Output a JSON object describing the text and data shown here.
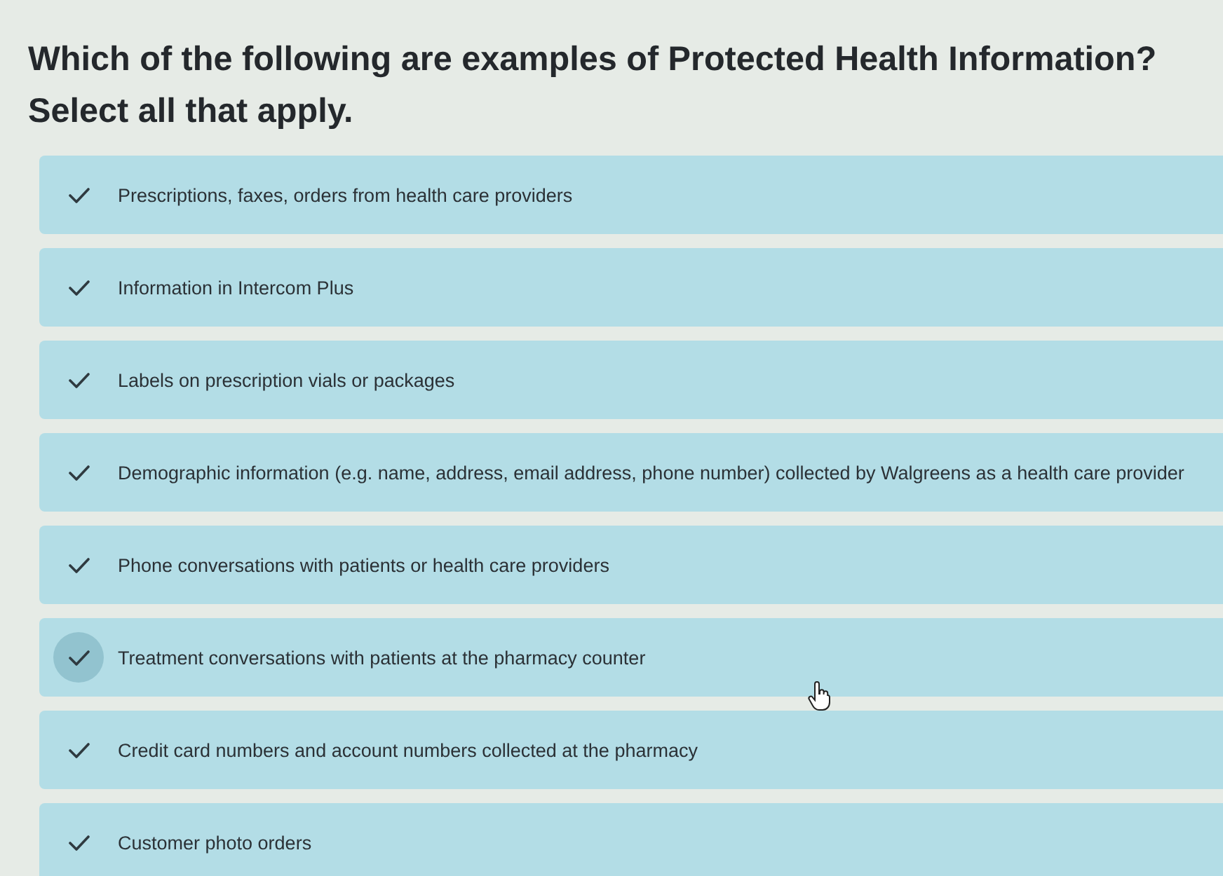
{
  "question": {
    "title": "Which of the following are examples of Protected Health Information?",
    "instruction": "Select all that apply."
  },
  "options": [
    {
      "label": "Prescriptions, faxes, orders from health care providers",
      "selected": true,
      "hovered": false
    },
    {
      "label": "Information in Intercom Plus",
      "selected": true,
      "hovered": false
    },
    {
      "label": "Labels on prescription vials or packages",
      "selected": true,
      "hovered": false
    },
    {
      "label": "Demographic information (e.g. name, address, email address, phone number) collected by Walgreens as a health care provider",
      "selected": true,
      "hovered": false
    },
    {
      "label": "Phone conversations with patients or health care providers",
      "selected": true,
      "hovered": false
    },
    {
      "label": "Treatment conversations with patients at the pharmacy counter",
      "selected": true,
      "hovered": true
    },
    {
      "label": "Credit card numbers and account numbers collected at the pharmacy",
      "selected": true,
      "hovered": false
    },
    {
      "label": "Customer photo orders",
      "selected": true,
      "hovered": false
    }
  ]
}
